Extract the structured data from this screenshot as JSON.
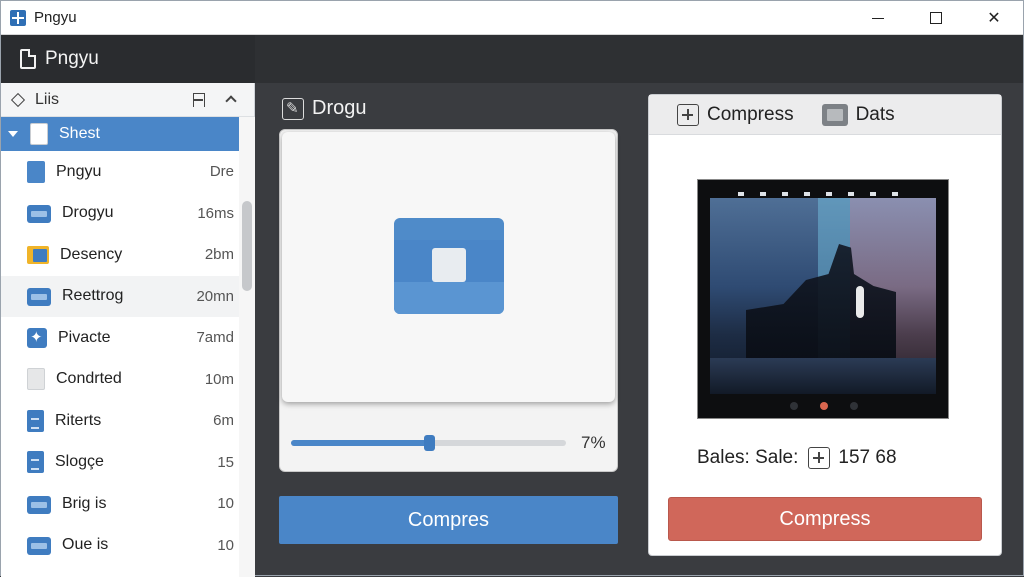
{
  "window": {
    "title": "Pngyu"
  },
  "header": {
    "title": "Pngyu"
  },
  "sidebar": {
    "heading": "Liis",
    "items": [
      {
        "label": "Shest",
        "meta": "",
        "icon": "document-icon",
        "selected": true
      },
      {
        "label": "Pngyu",
        "meta": "Dre",
        "icon": "document-blue-icon"
      },
      {
        "label": "Drogyu",
        "meta": "16ms",
        "icon": "box-icon"
      },
      {
        "label": "Desency",
        "meta": "2bm",
        "icon": "folder-icon"
      },
      {
        "label": "Reettrog",
        "meta": "20mn",
        "icon": "box-icon"
      },
      {
        "label": "Pivacte",
        "meta": "7amd",
        "icon": "spark-icon"
      },
      {
        "label": "Condrted",
        "meta": "10m",
        "icon": "document-gray-icon"
      },
      {
        "label": "Riterts",
        "meta": "6m",
        "icon": "lines-document-icon"
      },
      {
        "label": "Slogçe",
        "meta": "15",
        "icon": "lines-document-icon"
      },
      {
        "label": "Brig is",
        "meta": "10",
        "icon": "box-icon"
      },
      {
        "label": "Oue is",
        "meta": "10",
        "icon": "box-icon"
      }
    ]
  },
  "middle": {
    "title": "Drogu",
    "slider": {
      "value_label": "7%",
      "fraction": 0.5
    },
    "compress_label": "Compres"
  },
  "right": {
    "tabs": [
      {
        "label": "Compress",
        "icon": "plus-box-icon"
      },
      {
        "label": "Dats",
        "icon": "image-box-icon"
      }
    ],
    "stats": {
      "label": "Bales: Sale:",
      "value": "157 68"
    },
    "compress_label": "Compress"
  },
  "colors": {
    "accent_blue": "#4a86c8",
    "compress_red": "#d0675a",
    "dark_bg": "#3a3c40"
  }
}
